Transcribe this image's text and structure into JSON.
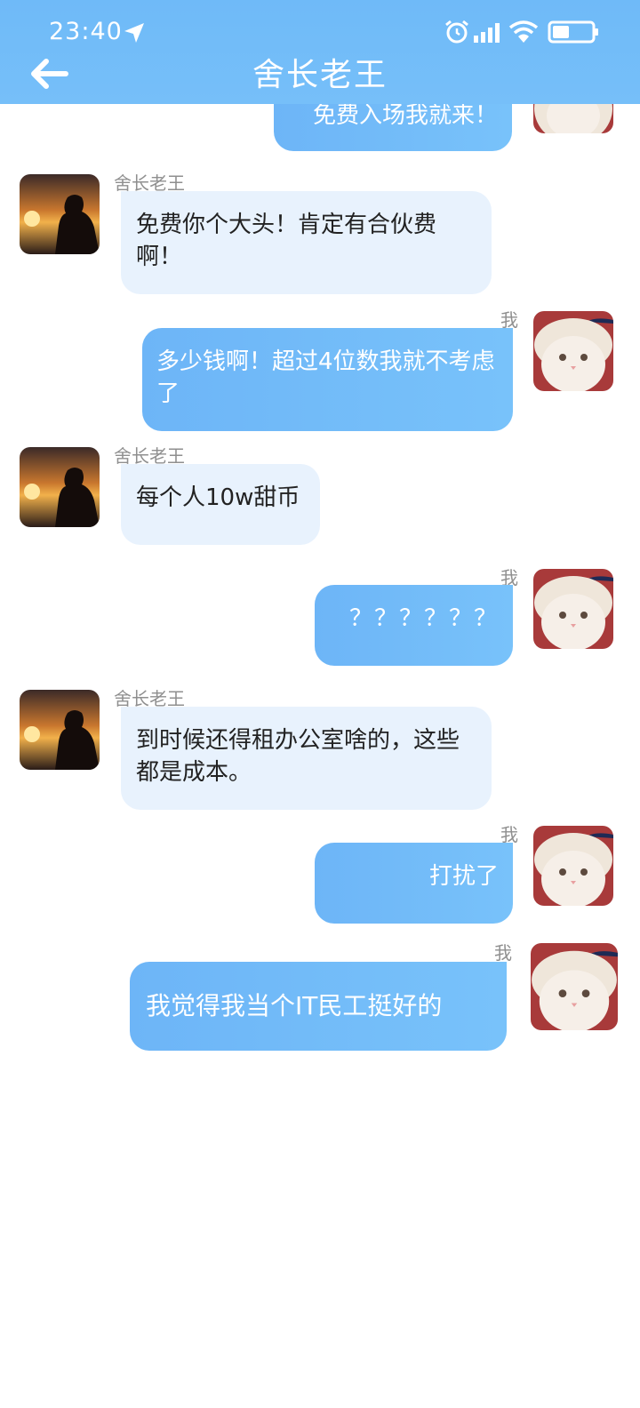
{
  "status_bar": {
    "time": "23:40"
  },
  "header": {
    "title": "舍长老王"
  },
  "messages": [
    {
      "sender": "me",
      "text": "免费入场我就来！"
    },
    {
      "sender": "舍长老王",
      "name": "舍长老王",
      "text": "免费你个大头！肯定有合伙费啊！"
    },
    {
      "sender": "me",
      "name": "我",
      "text": "多少钱啊！超过4位数我就不考虑了"
    },
    {
      "sender": "舍长老王",
      "name": "舍长老王",
      "text": "每个人10w甜币"
    },
    {
      "sender": "me",
      "name": "我",
      "text": "？？？？？？"
    },
    {
      "sender": "舍长老王",
      "name": "舍长老王",
      "text": "到时候还得租办公室啥的，这些都是成本。"
    },
    {
      "sender": "me",
      "name": "我",
      "text": "打扰了"
    },
    {
      "sender": "me",
      "name": "我",
      "text": "我觉得我当个IT民工挺好的"
    }
  ],
  "colors": {
    "header": "#6fbaf8",
    "incoming_bubble": "#e8f2fd",
    "outgoing_bubble": "#6db5f7"
  }
}
